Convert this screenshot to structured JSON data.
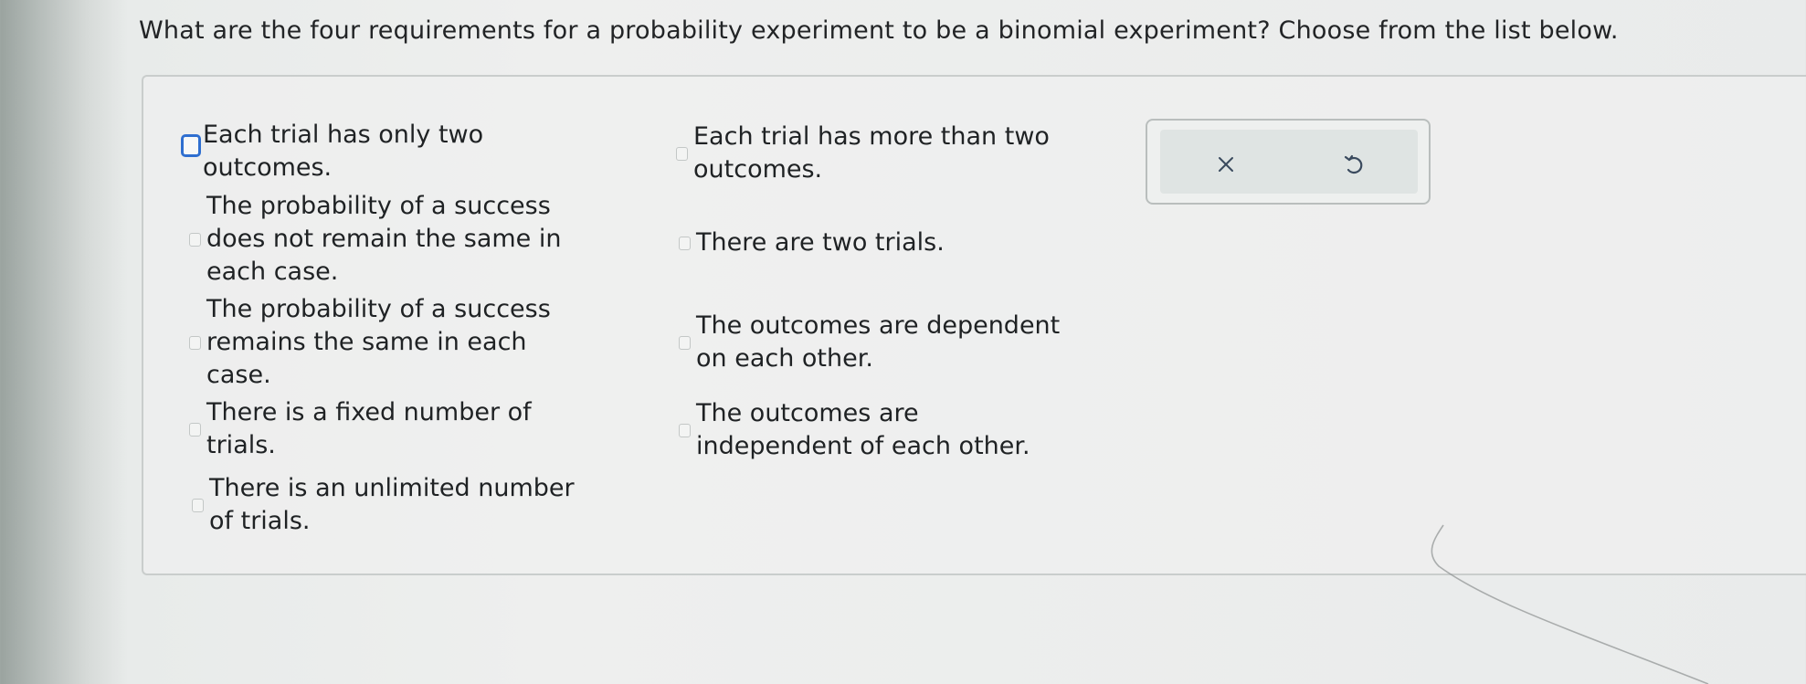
{
  "question": {
    "text": "What are the four requirements for a probability experiment to be a binomial experiment? Choose from the list below."
  },
  "options_left": [
    {
      "id": "two-outcomes",
      "label": "Each trial has only two\noutcomes.",
      "focused": true
    },
    {
      "id": "prob-not-same",
      "label": "The probability of a success\ndoes not remain the same in\neach case.",
      "focused": false
    },
    {
      "id": "prob-same",
      "label": "The probability of a success\nremains the same in each\ncase.",
      "focused": false
    },
    {
      "id": "fixed-trials",
      "label": "There is a fixed number of\ntrials.",
      "focused": false
    },
    {
      "id": "unlimited-trials",
      "label": "There is an unlimited number\nof trials.",
      "focused": false
    }
  ],
  "options_right": [
    {
      "id": "more-than-two",
      "label": "Each trial has more than two\noutcomes.",
      "focused": false
    },
    {
      "id": "two-trials",
      "label": "There are two trials.",
      "focused": false
    },
    {
      "id": "dependent",
      "label": "The outcomes are dependent\non each other.",
      "focused": false
    },
    {
      "id": "independent",
      "label": "The outcomes are\nindependent of each other.",
      "focused": false
    }
  ],
  "toolbar": {
    "clear_icon": "close-icon",
    "undo_icon": "undo-icon"
  },
  "colors": {
    "focus_blue": "#2f6fd0",
    "text": "#1f2224",
    "checkbox_border": "#c3c7c6"
  }
}
